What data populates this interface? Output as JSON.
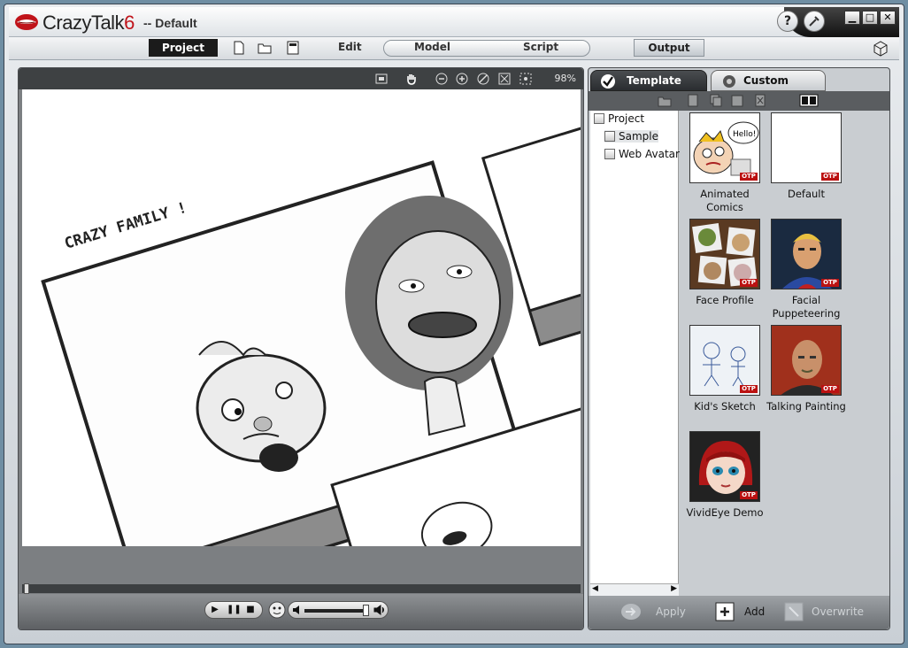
{
  "titlebar": {
    "app_name": "CrazyTalk",
    "app_version": "6",
    "project_name": "-- Default",
    "help": "?",
    "minimize": "▁",
    "maximize": "□",
    "close": "✕"
  },
  "toolbar": {
    "project": "Project",
    "edit": "Edit",
    "model": "Model",
    "script": "Script",
    "output": "Output"
  },
  "viewer": {
    "zoom": "98%",
    "sketch_caption": "CRAZY FAMILY !"
  },
  "panel": {
    "tabs": {
      "template": "Template",
      "custom": "Custom"
    },
    "tree": {
      "root": "Project",
      "items": [
        "Sample",
        "Web Avatar"
      ]
    },
    "thumb_badge": "OTP",
    "templates": [
      {
        "label": "Animated Comics",
        "icon": "cartoon-kid-thumb"
      },
      {
        "label": "Default",
        "icon": "blank-thumb"
      },
      {
        "label": "Face Profile",
        "icon": "face-profile-thumb"
      },
      {
        "label": "Facial Puppeteering",
        "icon": "superhero-thumb"
      },
      {
        "label": "Kid's Sketch",
        "icon": "sketch-thumb"
      },
      {
        "label": "Talking Painting",
        "icon": "painting-thumb"
      },
      {
        "label": "VividEye Demo",
        "icon": "vivideye-thumb"
      }
    ],
    "hello": "Hello!",
    "buttons": {
      "apply": "Apply",
      "add": "Add",
      "overwrite": "Overwrite"
    }
  },
  "colors": {
    "brand_red": "#c0131a",
    "otp_red": "#b11111",
    "panel_dark": "#2a2d30"
  }
}
